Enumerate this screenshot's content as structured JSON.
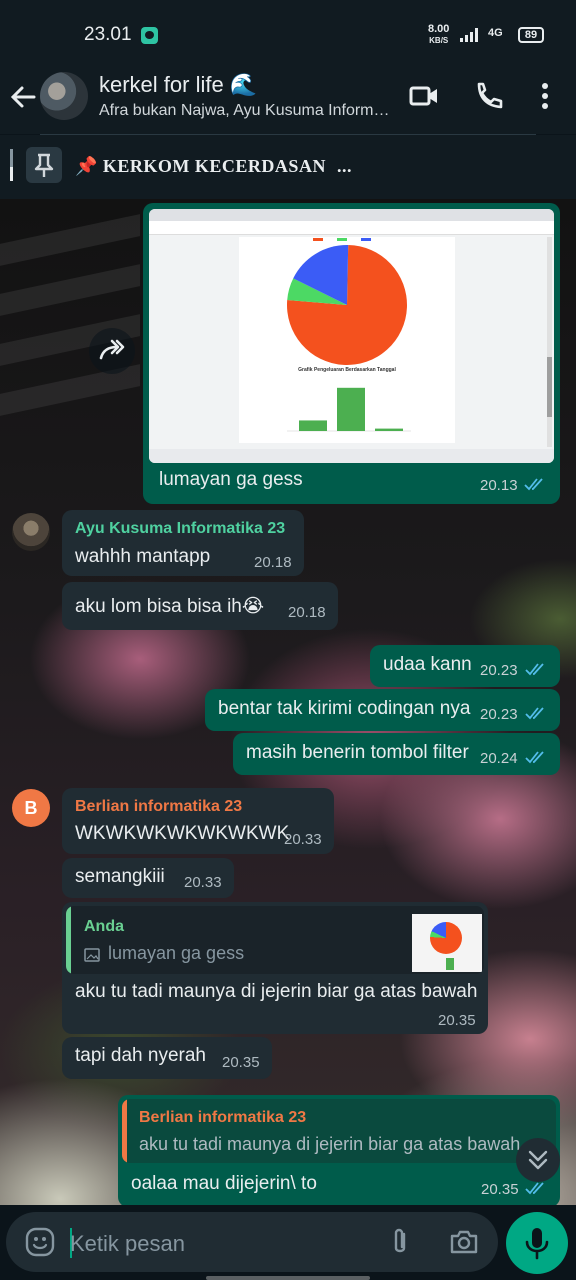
{
  "status_bar": {
    "time": "23.01",
    "speed_value": "8.00",
    "speed_unit": "KB/S",
    "network": "4G",
    "battery": "89"
  },
  "header": {
    "title": "kerkel for life",
    "title_emoji": "🌊",
    "subtitle": "Afra bukan Najwa, Ayu Kusuma Inform…"
  },
  "pinned": {
    "emoji": "📌",
    "text": "KERKOM KECERDASAN",
    "ellipsis": "..."
  },
  "image_message": {
    "caption": "lumayan ga gess",
    "time": "20.13",
    "chart_title": "Grafik Pengeluaran Berdasarkan Tanggal",
    "pie": [
      {
        "value": 76,
        "color": "#f4511e"
      },
      {
        "value": 6,
        "color": "#4cd964"
      },
      {
        "value": 18,
        "color": "#3b5cf6"
      }
    ],
    "bars": [
      0.22,
      0.9,
      0.05
    ]
  },
  "messages": [
    {
      "id": "m1",
      "sender": "Ayu Kusuma Informatika 23",
      "text": "wahhh mantapp",
      "time": "20.18"
    },
    {
      "id": "m2",
      "text": "aku lom bisa bisa ih😭",
      "time": "20.18"
    },
    {
      "id": "m3",
      "text": "udaa kann",
      "time": "20.23"
    },
    {
      "id": "m4",
      "text": "bentar tak kirimi codingan nya",
      "time": "20.23"
    },
    {
      "id": "m5",
      "text": "masih benerin tombol filter",
      "time": "20.24"
    },
    {
      "id": "m6",
      "sender": "Berlian informatika 23",
      "avatar_letter": "B",
      "text": "WKWKWKWKWKWKWK",
      "time": "20.33"
    },
    {
      "id": "m7",
      "text": "semangkiii",
      "time": "20.33"
    },
    {
      "id": "m8",
      "quote_author": "Anda",
      "quote_text": "lumayan ga gess",
      "text": "aku tu tadi maunya di jejerin biar ga atas bawah",
      "time": "20.35"
    },
    {
      "id": "m9",
      "text": "tapi dah nyerah",
      "time": "20.35"
    },
    {
      "id": "m10",
      "quote_author": "Berlian informatika 23",
      "quote_text": "aku tu tadi maunya di jejerin biar ga atas bawah",
      "text": "oalaa mau dijejerin\\ to",
      "time": "20.35"
    }
  ],
  "composer": {
    "placeholder": "Ketik pesan"
  },
  "colors": {
    "incoming": "#202c33",
    "outgoing": "#005c4b",
    "accent": "#00a884",
    "sender_ayu": "#4fd1a0",
    "sender_berlian": "#f07845",
    "quote_anda": "#6ad092",
    "tick_read": "#53bdeb"
  },
  "icons": [
    "back-arrow-icon",
    "video-call-icon",
    "phone-icon",
    "more-vert-icon",
    "pin-icon",
    "forward-icon",
    "emoji-icon",
    "attach-icon",
    "camera-icon",
    "mic-icon",
    "chevron-down-icon",
    "image-icon"
  ]
}
